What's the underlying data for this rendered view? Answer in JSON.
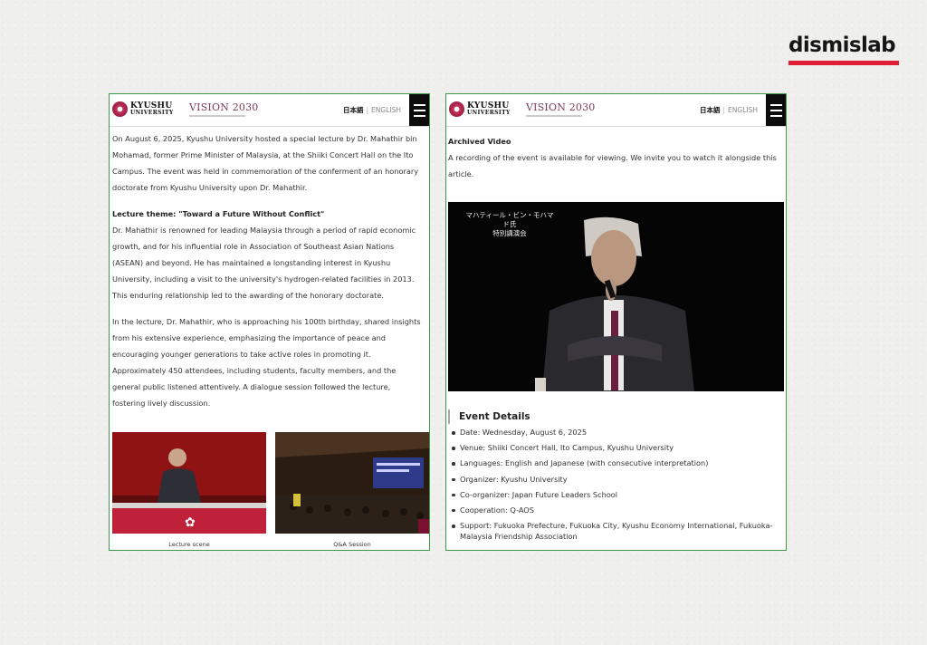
{
  "brand": {
    "name": "dismislab",
    "accent_color": "#e01f36"
  },
  "site": {
    "university_line1": "KYUSHU",
    "university_line2": "UNIVERSITY",
    "vision": "VISION 2030",
    "lang_ja": "日本語",
    "lang_en": "ENGLISH",
    "menu_icon": "hamburger-icon",
    "border_color": "#3d9a4b"
  },
  "left": {
    "para1": "On August 6, 2025, Kyushu University hosted a special lecture by Dr. Mahathir bin Mohamad, former Prime Minister of Malaysia, at the Shiiki Concert Hall on the Ito Campus. The event was held in commemoration of the conferment of an honorary doctorate from Kyushu University upon Dr. Mahathir.",
    "theme_heading": "Lecture theme: \"Toward a Future Without Conflict\"",
    "para2": "Dr. Mahathir is renowned for leading Malaysia through a period of rapid economic growth, and for his influential role in Association of Southeast Asian Nations (ASEAN) and beyond. He has maintained a longstanding interest in Kyushu University, including a visit to the university's hydrogen-related facilities in 2013. This enduring relationship led to the awarding of the honorary doctorate.",
    "para3": "In the lecture, Dr. Mahathir, who is approaching his 100th birthday, shared insights from his extensive experience, emphasizing the importance of peace and encouraging younger generations to take active roles in promoting it. Approximately 450 attendees, including students, faculty members, and the general public listened attentively. A dialogue session followed the lecture, fostering lively discussion.",
    "caption1": "Lecture scene",
    "caption2": "Q&A Session"
  },
  "right": {
    "archived_heading": "Archived Video",
    "archived_text": "A recording of the event is available for viewing. We invite you to watch it alongside this article.",
    "video_caption_line1": "マハティール・ビン・モハマド氏",
    "video_caption_line2": "特別講演会",
    "event_heading": "Event Details",
    "event_items": [
      "Date: Wednesday, August 6, 2025",
      "Venue: Shiiki Concert Hall, Ito Campus, Kyushu University",
      "Languages: English and Japanese (with consecutive interpretation)",
      "Organizer: Kyushu University",
      "Co-organizer: Japan Future Leaders School",
      "Cooperation: Q-AOS",
      "Support: Fukuoka Prefecture, Fukuoka City, Kyushu Economy International, Fukuoka-Malaysia Friendship Association"
    ]
  }
}
